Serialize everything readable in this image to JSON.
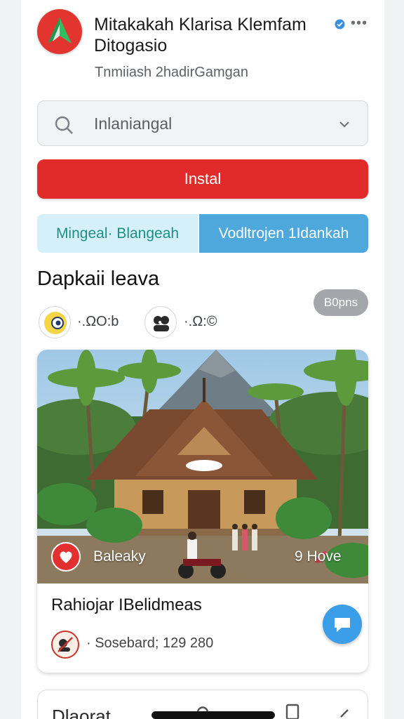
{
  "header": {
    "title": "Mitakakah Klarisa Klemfam Ditogasio",
    "subtitle": "Tnmiiash 2hadirGamgan",
    "logo_icon": "app-logo-icon",
    "verified_icon": "verified-icon",
    "more_icon": "more-icon",
    "more_glyph": "•••"
  },
  "search": {
    "value": "Inlaniangal",
    "icon": "search-icon",
    "dropdown_icon": "chevron-down-icon"
  },
  "install": {
    "label": "Instal",
    "color": "#e12b2b"
  },
  "segments": {
    "left_label": "Mingeal· Blangeah",
    "right_label": "Vodltrojen 1Idankah",
    "left_color": "#d6f0fa",
    "right_color": "#4ea8db"
  },
  "section": {
    "title": "Dapkaii leava",
    "badge": "B0pns",
    "stats": [
      {
        "icon": "emoji-icon",
        "text": "·.ΩO:b"
      },
      {
        "icon": "group-icon",
        "text": "·.Ω:©"
      }
    ]
  },
  "card": {
    "like_label": "Baleaky",
    "love_count": "9 Hove",
    "title": "Rahiojar IBelidmeas",
    "meta": "· Sosebard; 129 280",
    "image_icon": "village-photo",
    "chat_icon": "chat-bubble-icon"
  },
  "next_card": {
    "title": "Dlaorat"
  },
  "colors": {
    "accent_red": "#e23a32",
    "accent_blue": "#3b9ee8"
  }
}
